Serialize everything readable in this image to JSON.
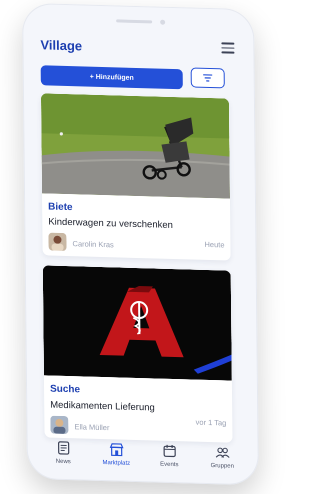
{
  "app": {
    "title": "Village"
  },
  "actions": {
    "add_label": "+ Hinzufügen"
  },
  "listings": [
    {
      "tag": "Biete",
      "title": "Kinderwagen zu verschenken",
      "author": "Carolin Kras",
      "date": "Heute"
    },
    {
      "tag": "Suche",
      "title": "Medikamenten Lieferung",
      "author": "Ella Müller",
      "date": "vor 1 Tag"
    }
  ],
  "tabs": [
    {
      "label": "News",
      "icon": "news-icon"
    },
    {
      "label": "Marktplatz",
      "icon": "store-icon",
      "active": true
    },
    {
      "label": "Events",
      "icon": "calendar-icon"
    },
    {
      "label": "Gruppen",
      "icon": "group-icon"
    }
  ],
  "colors": {
    "accent": "#2450d8",
    "brand": "#1d3fb0",
    "muted": "#9aa1b3"
  }
}
